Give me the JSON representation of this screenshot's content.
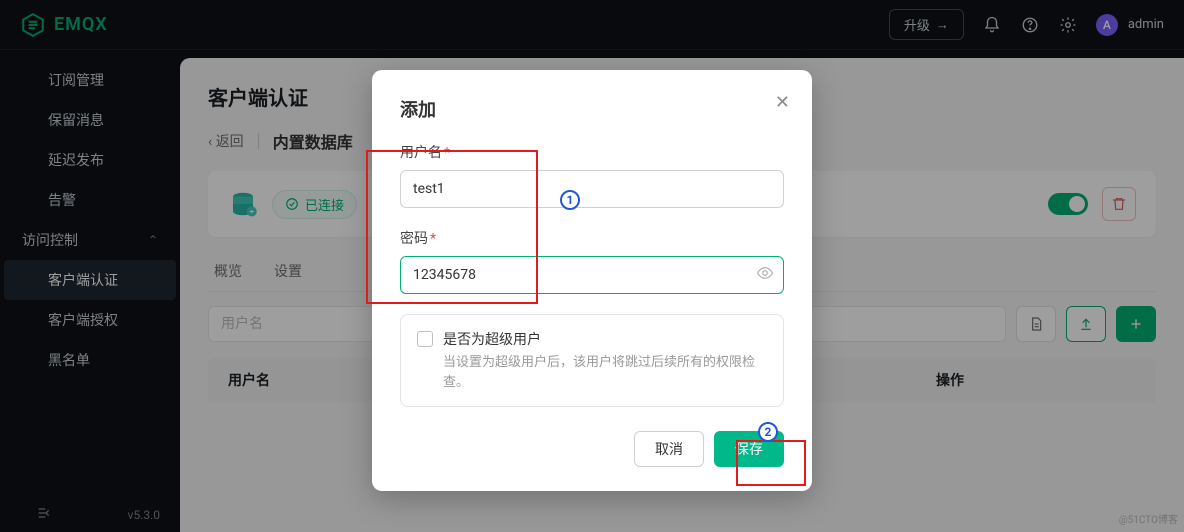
{
  "brand": "EMQX",
  "topbar": {
    "upgrade": "升级",
    "avatar_letter": "A",
    "username": "admin"
  },
  "sidebar": {
    "items": [
      {
        "label": "订阅管理"
      },
      {
        "label": "保留消息"
      },
      {
        "label": "延迟发布"
      },
      {
        "label": "告警"
      }
    ],
    "group": "访问控制",
    "sub_items": [
      {
        "label": "客户端认证",
        "active": true
      },
      {
        "label": "客户端授权"
      },
      {
        "label": "黑名单"
      }
    ],
    "version": "v5.3.0"
  },
  "page": {
    "title": "客户端认证",
    "back": "返回",
    "db_title": "内置数据库",
    "status": "已连接",
    "tabs": [
      "概览",
      "设置"
    ],
    "search_placeholder": "用户名",
    "col_user": "用户名",
    "col_action": "操作"
  },
  "modal": {
    "title": "添加",
    "username_label": "用户名",
    "username_value": "test1",
    "password_label": "密码",
    "password_value": "12345678",
    "superuser_title": "是否为超级用户",
    "superuser_desc": "当设置为超级用户后，该用户将跳过后续所有的权限检查。",
    "cancel": "取消",
    "save": "保存"
  },
  "annotations": {
    "badge1": "1",
    "badge2": "2"
  },
  "watermark": "@51CTO博客"
}
